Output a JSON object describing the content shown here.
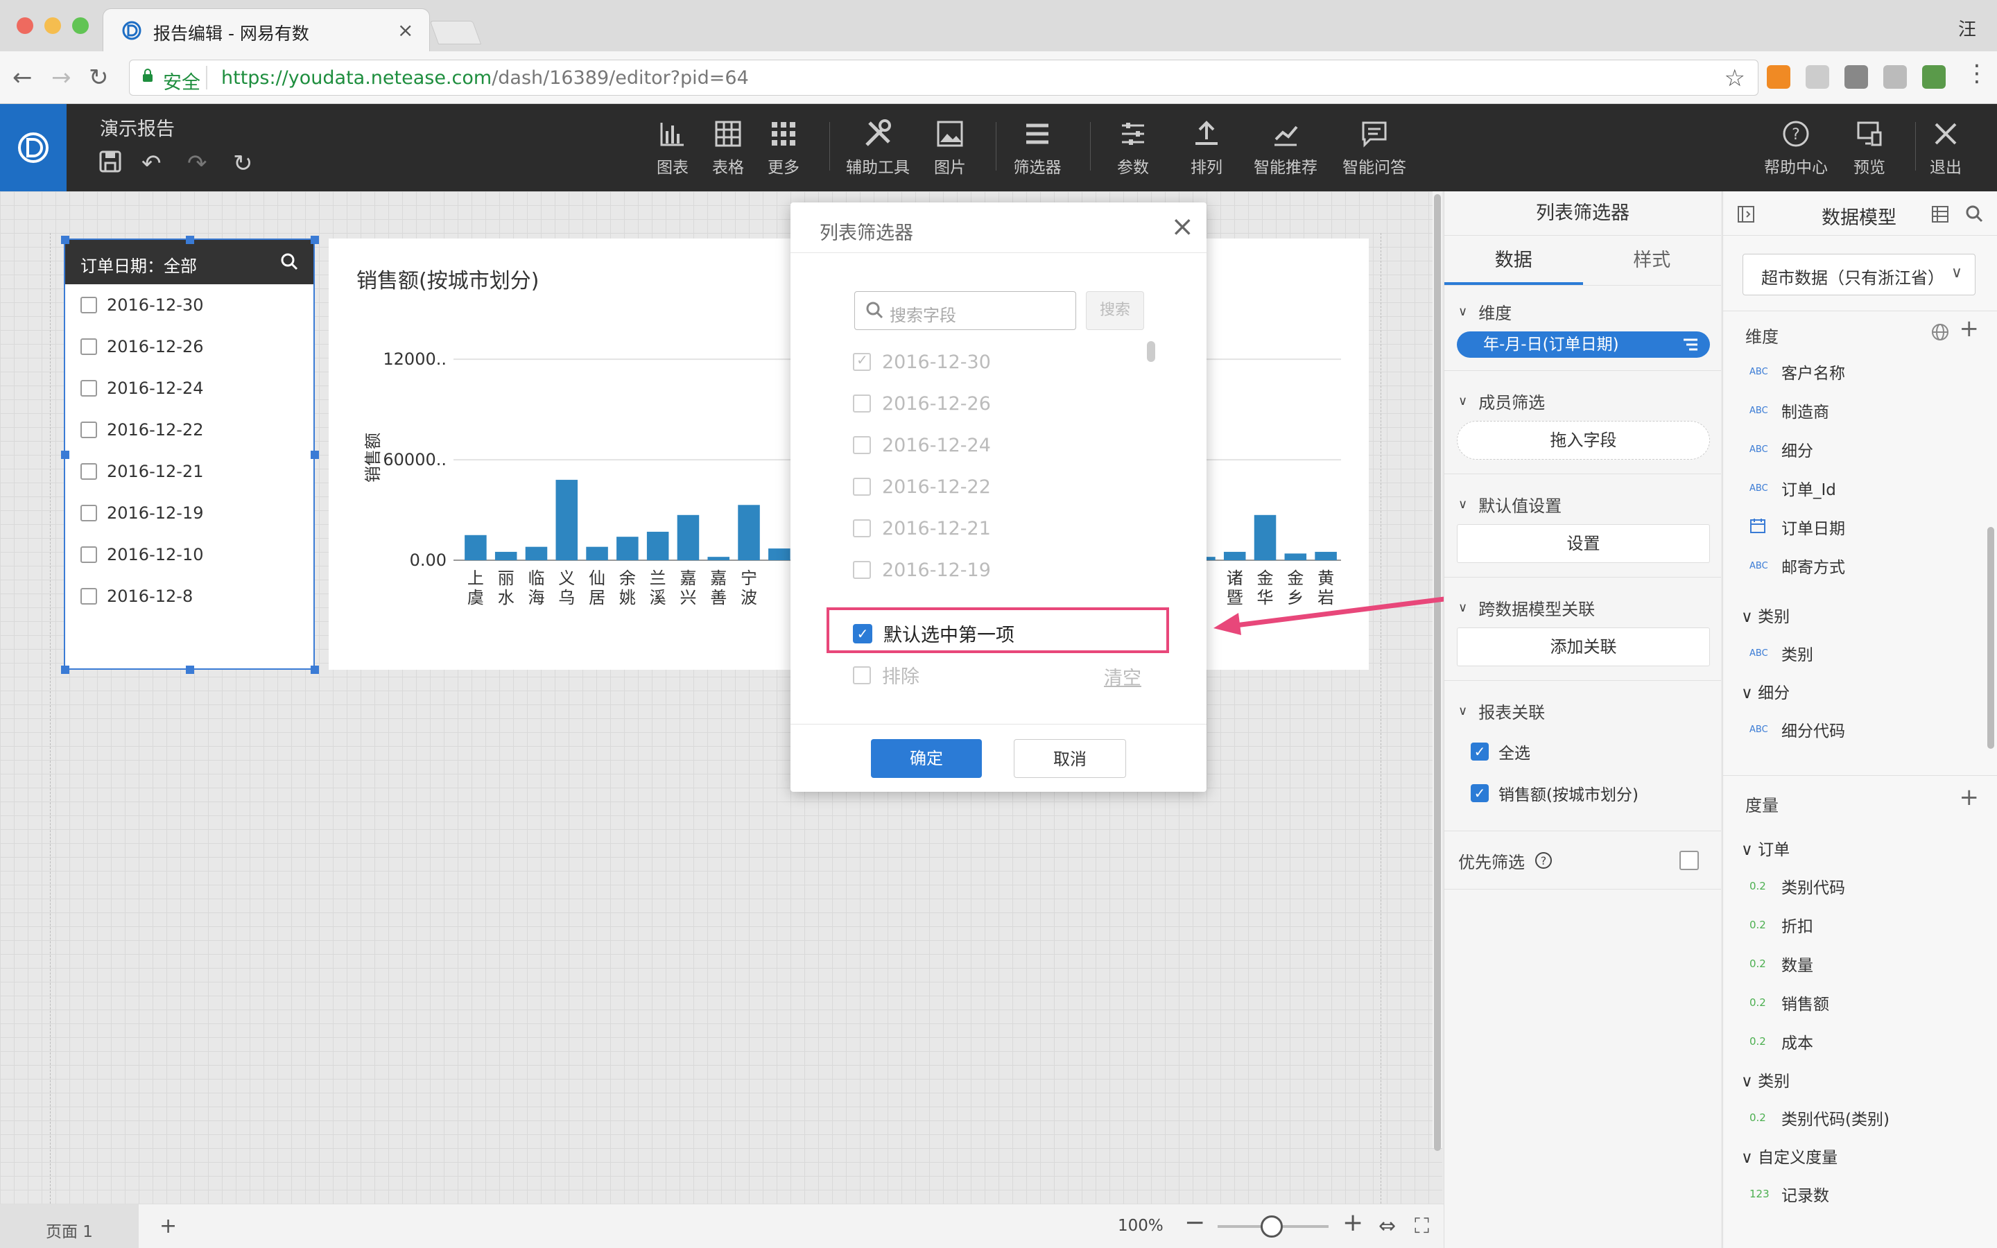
{
  "browser": {
    "tab_title": "报告编辑 - 网易有数",
    "tab_close": "×",
    "user_char": "汪",
    "secure_label": "安全",
    "url_scheme_host": "https://youdata.netease.com",
    "url_path": "/dash/16389/editor?pid=64"
  },
  "header": {
    "report_name": "演示报告",
    "tools": [
      {
        "label": "图表",
        "icon": "bar-chart-icon"
      },
      {
        "label": "表格",
        "icon": "table-icon"
      },
      {
        "label": "更多",
        "icon": "grid-icon"
      },
      {
        "label": "辅助工具",
        "icon": "tools-icon"
      },
      {
        "label": "图片",
        "icon": "image-icon"
      },
      {
        "label": "筛选器",
        "icon": "filter-list-icon"
      },
      {
        "label": "参数",
        "icon": "sliders-icon"
      },
      {
        "label": "排列",
        "icon": "arrange-icon"
      },
      {
        "label": "智能推荐",
        "icon": "trend-icon"
      },
      {
        "label": "智能问答",
        "icon": "chat-icon"
      }
    ],
    "right_tools": [
      {
        "label": "帮助中心",
        "icon": "help-icon"
      },
      {
        "label": "预览",
        "icon": "preview-icon"
      },
      {
        "label": "退出",
        "icon": "close-icon"
      }
    ]
  },
  "filter_widget": {
    "title": "订单日期：全部",
    "items": [
      "2016-12-30",
      "2016-12-26",
      "2016-12-24",
      "2016-12-22",
      "2016-12-21",
      "2016-12-19",
      "2016-12-10",
      "2016-12-8"
    ]
  },
  "chart": {
    "title": "销售额(按城市划分)"
  },
  "chart_data": {
    "type": "bar",
    "title": "销售额(按城市划分)",
    "ylabel": "销售额",
    "ytick_labels": [
      "0.00",
      "60000..",
      "12000.."
    ],
    "categories": [
      "上虞",
      "丽水",
      "临海",
      "义乌",
      "仙居",
      "余姚",
      "兰溪",
      "嘉兴",
      "嘉善",
      "宁波",
      "",
      "",
      "",
      "",
      "",
      "",
      "",
      "",
      "",
      "",
      "",
      "",
      "",
      "",
      "",
      "诸暨",
      "金华",
      "金乡",
      "黄岩"
    ],
    "values": [
      15000,
      5000,
      8000,
      48000,
      8000,
      14000,
      17000,
      27000,
      2000,
      33000,
      7000,
      0,
      0,
      0,
      0,
      0,
      0,
      0,
      0,
      0,
      0,
      0,
      0,
      0,
      2000,
      5000,
      27000,
      4000,
      5000
    ],
    "ylim": [
      0,
      130000
    ],
    "grid": true
  },
  "dialog": {
    "title": "列表筛选器",
    "close": "×",
    "search_placeholder": "搜索字段",
    "search_button": "搜索",
    "items": [
      {
        "label": "2016-12-30",
        "checked": true
      },
      {
        "label": "2016-12-26",
        "checked": false
      },
      {
        "label": "2016-12-24",
        "checked": false
      },
      {
        "label": "2016-12-22",
        "checked": false
      },
      {
        "label": "2016-12-21",
        "checked": false
      },
      {
        "label": "2016-12-19",
        "checked": false
      }
    ],
    "default_first_label": "默认选中第一项",
    "exclude_label": "排除",
    "clear_label": "清空",
    "ok_label": "确定",
    "cancel_label": "取消"
  },
  "panel_filter": {
    "title": "列表筛选器",
    "tab_data": "数据",
    "tab_style": "样式",
    "dim_label": "维度",
    "dim_pill": "年-月-日(订单日期)",
    "member_label": "成员筛选",
    "drag_field": "拖入字段",
    "default_label": "默认值设置",
    "set_button": "设置",
    "cross_label": "跨数据模型关联",
    "add_link": "添加关联",
    "report_link_label": "报表关联",
    "select_all": "全选",
    "linked_chart": "销售额(按城市划分)",
    "priority_label": "优先筛选"
  },
  "panel_model": {
    "title": "数据模型",
    "dataset": "超市数据（只有浙江省）",
    "dim_header": "维度",
    "dims": [
      {
        "type": "ABC",
        "label": "客户名称"
      },
      {
        "type": "ABC",
        "label": "制造商"
      },
      {
        "type": "ABC",
        "label": "细分"
      },
      {
        "type": "ABC",
        "label": "订单_Id"
      },
      {
        "type": "date",
        "label": "订单日期"
      },
      {
        "type": "ABC",
        "label": "邮寄方式"
      }
    ],
    "dim_group1": "类别",
    "dim_group1_item": "类别",
    "dim_group2": "细分",
    "dim_group2_item": "细分代码",
    "measure_header": "度量",
    "measure_group1": "订单",
    "measures": [
      "类别代码",
      "折扣",
      "数量",
      "销售额",
      "成本"
    ],
    "measure_group2": "类别",
    "measure_group2_item": "类别代码(类别)",
    "measure_group3": "自定义度量",
    "measure_group3_item": "记录数",
    "measure_type": "0.2",
    "count_type": "123"
  },
  "bottom": {
    "page_tab": "页面 1",
    "add_page": "+",
    "zoom": "100%"
  }
}
